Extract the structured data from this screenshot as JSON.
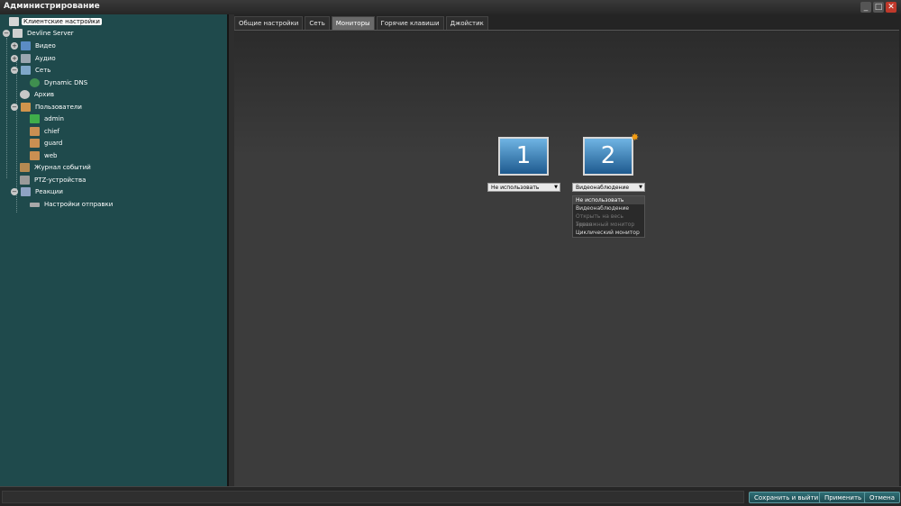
{
  "window": {
    "title": "Администрирование",
    "minimize": "_",
    "maximize": "□",
    "close": "✕"
  },
  "tree": [
    {
      "id": "client",
      "label": "Клиентские настройки",
      "icon": "client-settings-icon",
      "selected": true,
      "level": 0
    },
    {
      "id": "server",
      "label": "Devline Server",
      "icon": "server-icon",
      "expander": "−",
      "level": 0
    },
    {
      "id": "video",
      "label": "Видео",
      "icon": "video-icon",
      "expander": "+",
      "level": 1
    },
    {
      "id": "audio",
      "label": "Аудио",
      "icon": "audio-icon",
      "expander": "+",
      "level": 1
    },
    {
      "id": "network",
      "label": "Сеть",
      "icon": "network-icon",
      "expander": "−",
      "level": 1
    },
    {
      "id": "dns",
      "label": "Dynamic DNS",
      "icon": "dns-icon",
      "level": 2
    },
    {
      "id": "archive",
      "label": "Архив",
      "icon": "archive-icon",
      "level": 1
    },
    {
      "id": "users",
      "label": "Пользователи",
      "icon": "users-icon",
      "expander": "−",
      "level": 1
    },
    {
      "id": "admin",
      "label": "admin",
      "icon": "user-admin-icon",
      "level": 2
    },
    {
      "id": "chief",
      "label": "chief",
      "icon": "user-icon",
      "level": 2
    },
    {
      "id": "guard",
      "label": "guard",
      "icon": "user-icon",
      "level": 2
    },
    {
      "id": "web",
      "label": "web",
      "icon": "user-icon",
      "level": 2
    },
    {
      "id": "events",
      "label": "Журнал событий",
      "icon": "event-log-icon",
      "level": 1
    },
    {
      "id": "ptz",
      "label": "PTZ-устройства",
      "icon": "ptz-icon",
      "level": 1
    },
    {
      "id": "reactions",
      "label": "Реакции",
      "icon": "reactions-icon",
      "expander": "−",
      "level": 1
    },
    {
      "id": "send",
      "label": "Настройки отправки",
      "icon": "send-settings-icon",
      "level": 2
    }
  ],
  "tabs": [
    "Общие настройки",
    "Сеть",
    "Мониторы",
    "Горячие клавиши",
    "Джойстик"
  ],
  "active_tab": "Мониторы",
  "monitors": [
    {
      "number": "1",
      "mode": "Не использовать"
    },
    {
      "number": "2",
      "mode": "Видеонаблюдение",
      "primary": true
    }
  ],
  "dropdown_options": [
    "Не использовать",
    "Видеонаблюдение",
    "Открыть на весь экран",
    "Тревожный монитор",
    "Циклический монитор"
  ],
  "buttons": {
    "save_exit": "Сохранить и выйти",
    "apply": "Применить",
    "cancel": "Отмена"
  },
  "colors": {
    "tree_bg": "#1f4a4c",
    "accent_button": "#2e6e75",
    "star": "#f39c12"
  }
}
